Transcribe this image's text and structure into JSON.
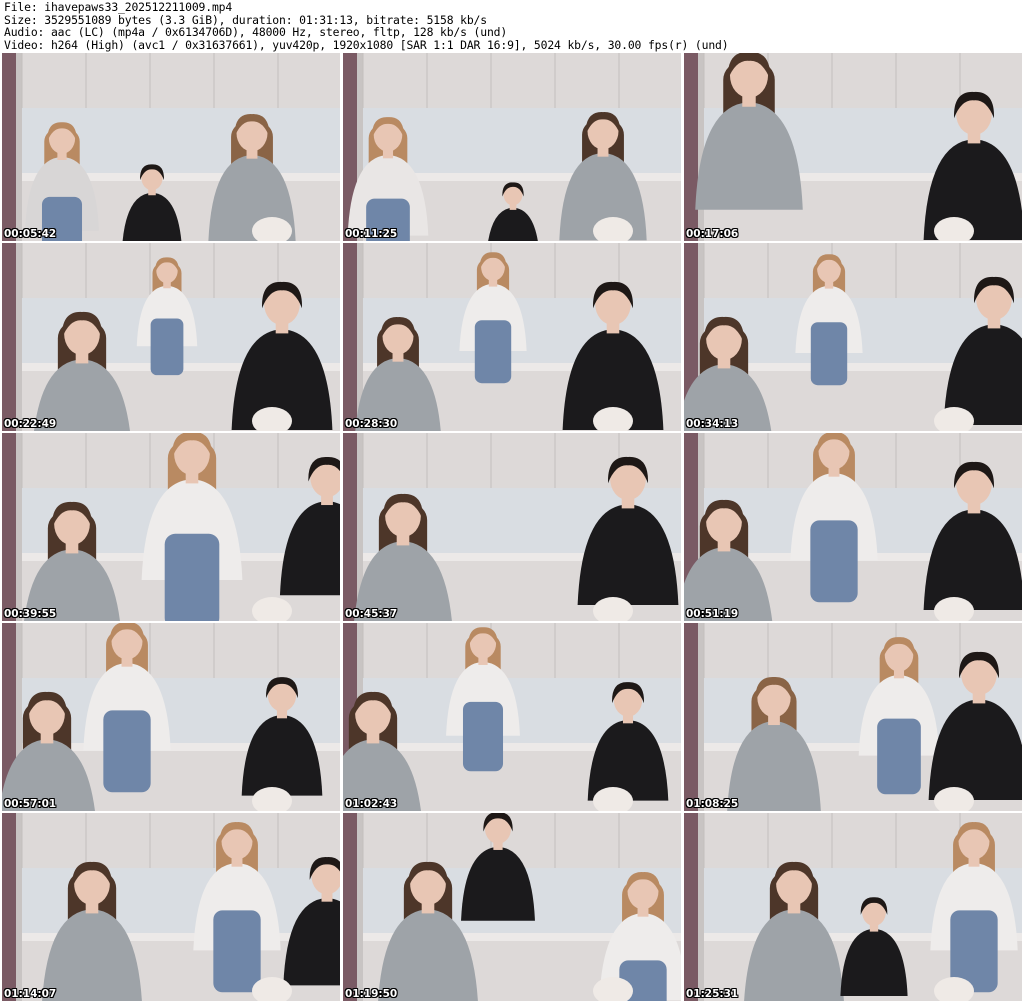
{
  "header": {
    "file": "File: ihavepaws33_202512211009.mp4",
    "size": "Size: 3529551089 bytes (3.3 GiB), duration: 01:31:13, bitrate: 5158 kb/s",
    "audio": "Audio: aac (LC) (mp4a / 0x6134706D), 48000 Hz, stereo, fltp, 128 kb/s (und)",
    "video": "Video: h264 (High) (avc1 / 0x31637661), yuv420p, 1920x1080 [SAR 1:1 DAR 16:9], 5024 kb/s, 30.00 fps(r) (und)"
  },
  "thumbnails": [
    {
      "timestamp": "00:05:42"
    },
    {
      "timestamp": "00:11:25"
    },
    {
      "timestamp": "00:17:06"
    },
    {
      "timestamp": "00:22:49"
    },
    {
      "timestamp": "00:28:30"
    },
    {
      "timestamp": "00:34:13"
    },
    {
      "timestamp": "00:39:55"
    },
    {
      "timestamp": "00:45:37"
    },
    {
      "timestamp": "00:51:19"
    },
    {
      "timestamp": "00:57:01"
    },
    {
      "timestamp": "01:02:43"
    },
    {
      "timestamp": "01:08:25"
    },
    {
      "timestamp": "01:14:07"
    },
    {
      "timestamp": "01:19:50"
    },
    {
      "timestamp": "01:25:31"
    }
  ],
  "colors": {
    "wall": "#c8c4c3",
    "cabinets": "#ddd9d8",
    "counter": "#ece9e8",
    "sweater_gray": "#9ea3a8",
    "black_top": "#1b1a1c",
    "denim": "#6f86a8",
    "hair_brown": "#6b4a36",
    "hair_dark": "#1e1816",
    "skin": "#e8c6b4",
    "mug": "#efeae6",
    "door_frame": "#7a5a64"
  }
}
